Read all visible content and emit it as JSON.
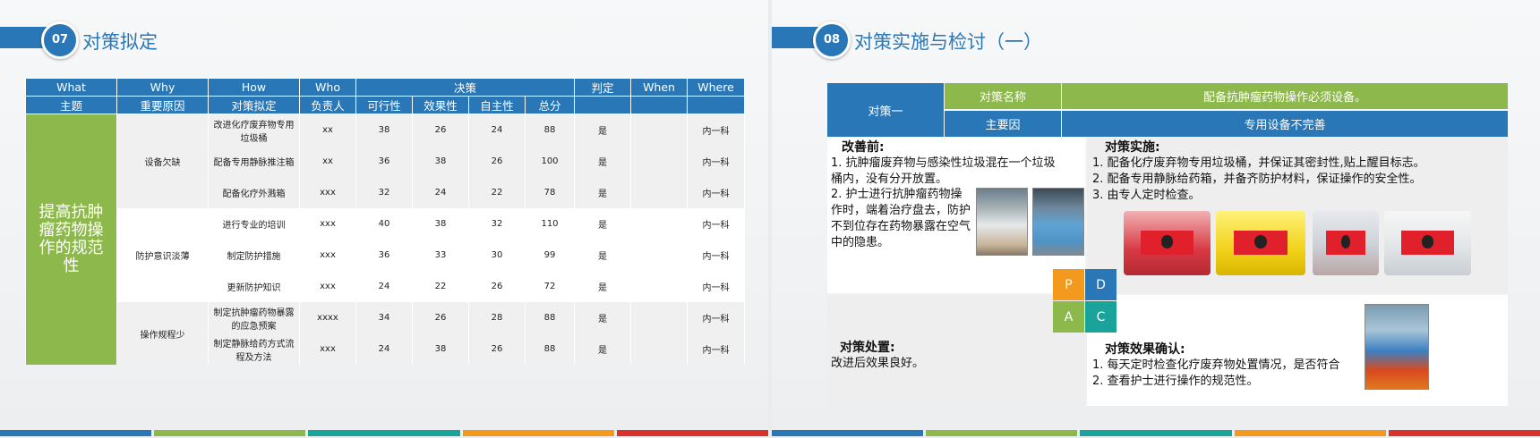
{
  "left": {
    "number": "07",
    "title": "对策拟定",
    "headers_top": {
      "what": "What",
      "why": "Why",
      "how": "How",
      "who": "Who",
      "decision": "决策",
      "judge": "判定",
      "when": "When",
      "where": "Where"
    },
    "headers_sub": {
      "theme": "主题",
      "reason": "重要原因",
      "measure": "对策拟定",
      "owner": "负责人",
      "feasibility": "可行性",
      "effectiveness": "效果性",
      "autonomy": "自主性",
      "total": "总分"
    },
    "topic": "提高抗肿瘤药物操作的规范性",
    "groups": [
      {
        "reason": "设备欠缺",
        "rows": [
          {
            "measure": "改进化疗废弃物专用垃圾桶",
            "owner": "xx",
            "f": "38",
            "e": "26",
            "a": "24",
            "t": "88",
            "judge": "是",
            "when": "",
            "where": "内一科"
          },
          {
            "measure": "配备专用静脉推注箱",
            "owner": "xx",
            "f": "36",
            "e": "38",
            "a": "26",
            "t": "100",
            "judge": "是",
            "when": "",
            "where": "内一科"
          },
          {
            "measure": "配备化疗外溅箱",
            "owner": "xxx",
            "f": "32",
            "e": "24",
            "a": "22",
            "t": "78",
            "judge": "是",
            "when": "",
            "where": "内一科"
          }
        ]
      },
      {
        "reason": "防护意识淡薄",
        "rows": [
          {
            "measure": "进行专业的培训",
            "owner": "xxx",
            "f": "40",
            "e": "38",
            "a": "32",
            "t": "110",
            "judge": "是",
            "when": "",
            "where": "内一科"
          },
          {
            "measure": "制定防护措施",
            "owner": "xxx",
            "f": "36",
            "e": "33",
            "a": "30",
            "t": "99",
            "judge": "是",
            "when": "",
            "where": "内一科"
          },
          {
            "measure": "更新防护知识",
            "owner": "xxx",
            "f": "24",
            "e": "22",
            "a": "26",
            "t": "72",
            "judge": "是",
            "when": "",
            "where": "内一科"
          }
        ]
      },
      {
        "reason": "操作规程少",
        "rows": [
          {
            "measure": "制定抗肿瘤药物暴露的应急预案",
            "owner": "xxxx",
            "f": "34",
            "e": "26",
            "a": "28",
            "t": "88",
            "judge": "是",
            "when": "",
            "where": "内一科"
          },
          {
            "measure": "制定静脉给药方式流程及方法",
            "owner": "xxx",
            "f": "24",
            "e": "38",
            "a": "26",
            "t": "88",
            "judge": "是",
            "when": "",
            "where": "内一科"
          }
        ]
      }
    ]
  },
  "right": {
    "number": "08",
    "title": "对策实施与检讨（一）",
    "countermeasure_label": "对策一",
    "name_label": "对策名称",
    "name_value": "配备抗肿瘤药物操作必须设备。",
    "cause_label": "主要因",
    "cause_value": "专用设备不完善",
    "before_title": "改善前:",
    "before_lines": [
      "1. 抗肿瘤废弃物与感染性垃圾混在一个垃圾桶内，没有分开放置。",
      "2. 护士进行抗肿瘤药物操作时，端着治疗盘去，防护不到位存在药物暴露在空气中的隐患。"
    ],
    "implement_title": "对策实施:",
    "implement_lines": [
      "1. 配备化疗废弃物专用垃圾桶，并保证其密封性,贴上醒目标志。",
      "2. 配备专用静脉给药箱，并备齐防护材料，保证操作的安全性。",
      "3. 由专人定时检查。"
    ],
    "pdca": [
      "P",
      "D",
      "A",
      "C"
    ],
    "disposal_title": "对策处置:",
    "disposal_text": "改进后效果良好。",
    "confirm_title": "对策效果确认:",
    "confirm_lines": [
      "1.   每天定时检查化疗废弃物处置情况，是否符合",
      "2.   查看护士进行操作的规范性。"
    ]
  },
  "colors": {
    "brand_blue": "#2a77b7",
    "accent_green": "#8db84b",
    "pdca_orange": "#f39a1e",
    "pdca_teal": "#1aa39a",
    "strip": [
      "#2a77b7",
      "#8db84b",
      "#1aa39a",
      "#f39a1e",
      "#d9322c"
    ]
  }
}
